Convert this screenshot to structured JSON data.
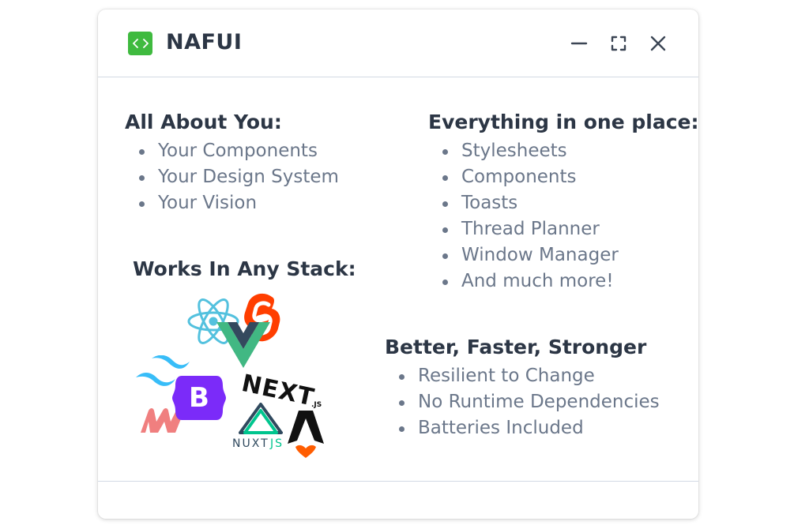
{
  "window": {
    "title": "NAFUI",
    "icon": "code-brackets-icon",
    "controls": [
      "minimize-icon",
      "maximize-icon",
      "close-icon"
    ],
    "accent_color": "#3fba3f"
  },
  "sections": {
    "about": {
      "heading": "All About You:",
      "items": [
        "Your Components",
        "Your Design System",
        "Your Vision"
      ]
    },
    "everything": {
      "heading": "Everything in one place:",
      "items": [
        "Stylesheets",
        "Components",
        "Toasts",
        "Thread Planner",
        "Window Manager",
        "And much more!"
      ]
    },
    "stack": {
      "heading": "Works In Any Stack:",
      "logos": [
        "react-icon",
        "svelte-icon",
        "vue-icon",
        "tailwind-icon",
        "bootstrap-icon",
        "windi-icon",
        "nextjs-icon",
        "nuxtjs-icon",
        "astro-icon"
      ],
      "bootstrap_letter": "B",
      "next_text": "NEXT",
      "next_suffix": ".JS",
      "nuxt_text": "NUXT",
      "nuxt_suffix": "JS"
    },
    "better": {
      "heading": "Better, Faster, Stronger",
      "items": [
        "Resilient to Change",
        "No Runtime Dependencies",
        "Batteries Included"
      ]
    }
  }
}
